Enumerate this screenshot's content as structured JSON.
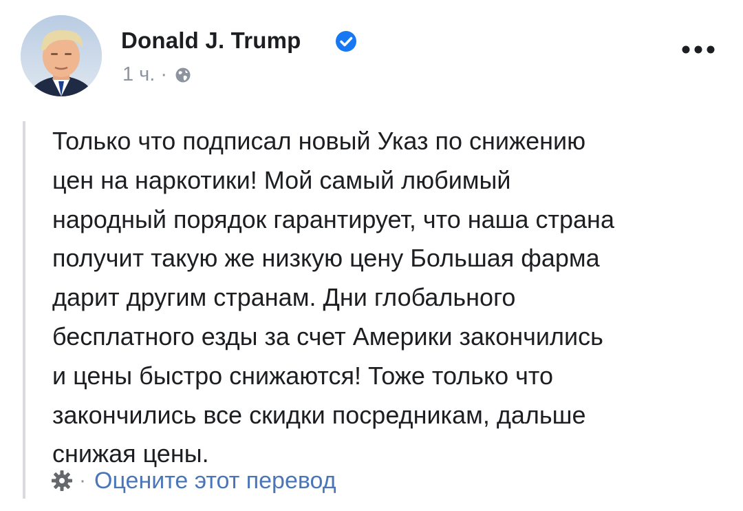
{
  "post": {
    "author": "Donald J. Trump",
    "verified": true,
    "time": "1 ч.",
    "separator": "·",
    "privacy_icon": "globe-icon",
    "more_icon": "more-horizontal-icon",
    "text": "Только что подписал новый Указ по снижению\nцен на наркотики! Мой самый любимый\nнародный порядок гарантирует, что наша страна\nполучит такую же низкую цену Большая фарма\nдарит другим странам. Дни глобального\nбесплатного езды за счет Америки закончились\nи цены быстро снижаются! Тоже только что\nзакончились все скидки посредникам, дальше\nснижая цены."
  },
  "translation": {
    "icon": "gear-icon",
    "separator": "·",
    "rate_label": "Оцените этот перевод"
  },
  "colors": {
    "text": "#1c1e21",
    "meta": "#8d949e",
    "verified": "#1877f2",
    "link": "#4a76b8",
    "quote_bar": "#d8dadf"
  }
}
